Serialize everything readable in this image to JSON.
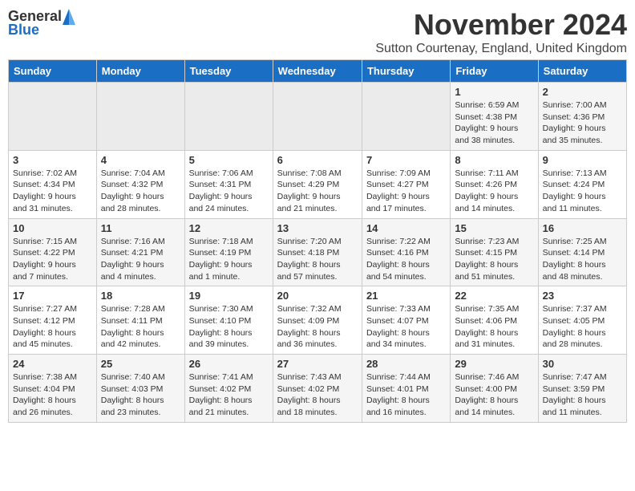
{
  "header": {
    "logo_general": "General",
    "logo_blue": "Blue",
    "month_title": "November 2024",
    "subtitle": "Sutton Courtenay, England, United Kingdom"
  },
  "weekdays": [
    "Sunday",
    "Monday",
    "Tuesday",
    "Wednesday",
    "Thursday",
    "Friday",
    "Saturday"
  ],
  "weeks": [
    [
      {
        "day": "",
        "info": ""
      },
      {
        "day": "",
        "info": ""
      },
      {
        "day": "",
        "info": ""
      },
      {
        "day": "",
        "info": ""
      },
      {
        "day": "",
        "info": ""
      },
      {
        "day": "1",
        "info": "Sunrise: 6:59 AM\nSunset: 4:38 PM\nDaylight: 9 hours\nand 38 minutes."
      },
      {
        "day": "2",
        "info": "Sunrise: 7:00 AM\nSunset: 4:36 PM\nDaylight: 9 hours\nand 35 minutes."
      }
    ],
    [
      {
        "day": "3",
        "info": "Sunrise: 7:02 AM\nSunset: 4:34 PM\nDaylight: 9 hours\nand 31 minutes."
      },
      {
        "day": "4",
        "info": "Sunrise: 7:04 AM\nSunset: 4:32 PM\nDaylight: 9 hours\nand 28 minutes."
      },
      {
        "day": "5",
        "info": "Sunrise: 7:06 AM\nSunset: 4:31 PM\nDaylight: 9 hours\nand 24 minutes."
      },
      {
        "day": "6",
        "info": "Sunrise: 7:08 AM\nSunset: 4:29 PM\nDaylight: 9 hours\nand 21 minutes."
      },
      {
        "day": "7",
        "info": "Sunrise: 7:09 AM\nSunset: 4:27 PM\nDaylight: 9 hours\nand 17 minutes."
      },
      {
        "day": "8",
        "info": "Sunrise: 7:11 AM\nSunset: 4:26 PM\nDaylight: 9 hours\nand 14 minutes."
      },
      {
        "day": "9",
        "info": "Sunrise: 7:13 AM\nSunset: 4:24 PM\nDaylight: 9 hours\nand 11 minutes."
      }
    ],
    [
      {
        "day": "10",
        "info": "Sunrise: 7:15 AM\nSunset: 4:22 PM\nDaylight: 9 hours\nand 7 minutes."
      },
      {
        "day": "11",
        "info": "Sunrise: 7:16 AM\nSunset: 4:21 PM\nDaylight: 9 hours\nand 4 minutes."
      },
      {
        "day": "12",
        "info": "Sunrise: 7:18 AM\nSunset: 4:19 PM\nDaylight: 9 hours\nand 1 minute."
      },
      {
        "day": "13",
        "info": "Sunrise: 7:20 AM\nSunset: 4:18 PM\nDaylight: 8 hours\nand 57 minutes."
      },
      {
        "day": "14",
        "info": "Sunrise: 7:22 AM\nSunset: 4:16 PM\nDaylight: 8 hours\nand 54 minutes."
      },
      {
        "day": "15",
        "info": "Sunrise: 7:23 AM\nSunset: 4:15 PM\nDaylight: 8 hours\nand 51 minutes."
      },
      {
        "day": "16",
        "info": "Sunrise: 7:25 AM\nSunset: 4:14 PM\nDaylight: 8 hours\nand 48 minutes."
      }
    ],
    [
      {
        "day": "17",
        "info": "Sunrise: 7:27 AM\nSunset: 4:12 PM\nDaylight: 8 hours\nand 45 minutes."
      },
      {
        "day": "18",
        "info": "Sunrise: 7:28 AM\nSunset: 4:11 PM\nDaylight: 8 hours\nand 42 minutes."
      },
      {
        "day": "19",
        "info": "Sunrise: 7:30 AM\nSunset: 4:10 PM\nDaylight: 8 hours\nand 39 minutes."
      },
      {
        "day": "20",
        "info": "Sunrise: 7:32 AM\nSunset: 4:09 PM\nDaylight: 8 hours\nand 36 minutes."
      },
      {
        "day": "21",
        "info": "Sunrise: 7:33 AM\nSunset: 4:07 PM\nDaylight: 8 hours\nand 34 minutes."
      },
      {
        "day": "22",
        "info": "Sunrise: 7:35 AM\nSunset: 4:06 PM\nDaylight: 8 hours\nand 31 minutes."
      },
      {
        "day": "23",
        "info": "Sunrise: 7:37 AM\nSunset: 4:05 PM\nDaylight: 8 hours\nand 28 minutes."
      }
    ],
    [
      {
        "day": "24",
        "info": "Sunrise: 7:38 AM\nSunset: 4:04 PM\nDaylight: 8 hours\nand 26 minutes."
      },
      {
        "day": "25",
        "info": "Sunrise: 7:40 AM\nSunset: 4:03 PM\nDaylight: 8 hours\nand 23 minutes."
      },
      {
        "day": "26",
        "info": "Sunrise: 7:41 AM\nSunset: 4:02 PM\nDaylight: 8 hours\nand 21 minutes."
      },
      {
        "day": "27",
        "info": "Sunrise: 7:43 AM\nSunset: 4:02 PM\nDaylight: 8 hours\nand 18 minutes."
      },
      {
        "day": "28",
        "info": "Sunrise: 7:44 AM\nSunset: 4:01 PM\nDaylight: 8 hours\nand 16 minutes."
      },
      {
        "day": "29",
        "info": "Sunrise: 7:46 AM\nSunset: 4:00 PM\nDaylight: 8 hours\nand 14 minutes."
      },
      {
        "day": "30",
        "info": "Sunrise: 7:47 AM\nSunset: 3:59 PM\nDaylight: 8 hours\nand 11 minutes."
      }
    ]
  ]
}
